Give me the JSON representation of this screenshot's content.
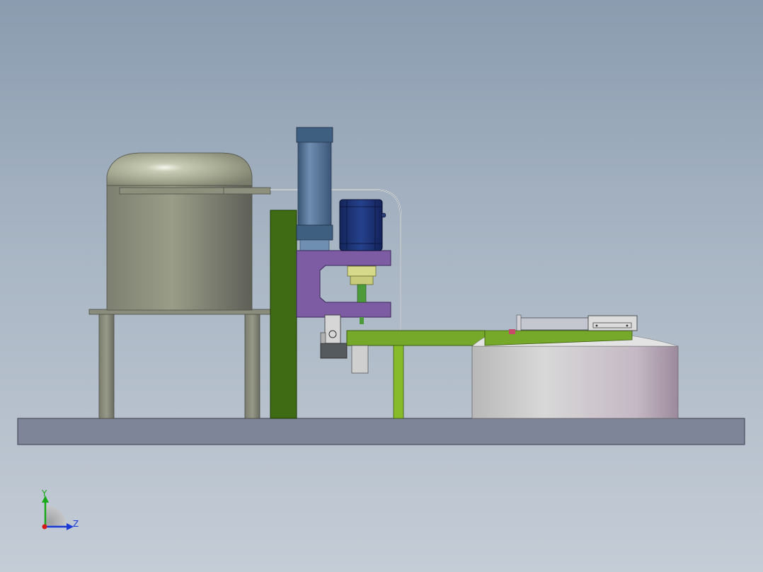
{
  "viewport": {
    "background_top": "#8b9cb0",
    "background_bottom": "#c4ccd6"
  },
  "model": {
    "base_plate_color": "#7f8598",
    "tank_color": "#8a8d78",
    "column_color": "#3f6b14",
    "cylinder_color": "#4e6e8f",
    "motor_color": "#1a2f6e",
    "bracket_color": "#7d5ca3",
    "arm_color": "#76a92a",
    "drum_color": "#c9c6c6"
  },
  "triad": {
    "y_label": "Y",
    "z_label": "Z",
    "y_color": "#1aa81a",
    "z_color": "#1a3ad6",
    "x_color": "#d61a1a"
  }
}
